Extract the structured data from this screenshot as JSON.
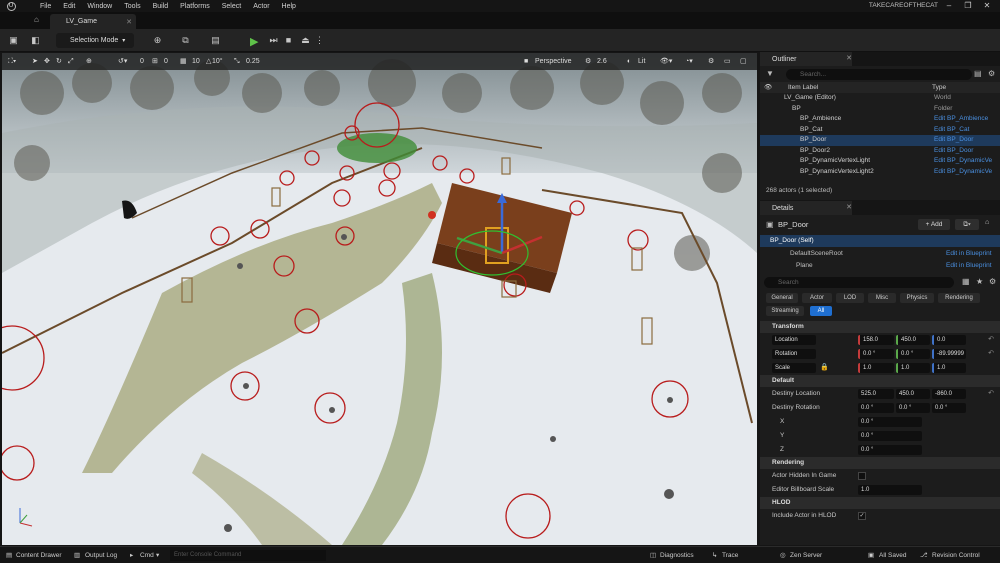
{
  "menubar": {
    "items": [
      "File",
      "Edit",
      "Window",
      "Tools",
      "Build",
      "Platforms",
      "Select",
      "Actor",
      "Help"
    ],
    "project": "TAKECAREOFTHECAT"
  },
  "tabs": {
    "level": "LV_Game"
  },
  "toolbar": {
    "selection_mode": "Selection Mode"
  },
  "viewport": {
    "view_mode": "Perspective",
    "fov": "2.6",
    "lighting": "Lit",
    "snap_move": "10",
    "snap_rotate": "10°",
    "snap_scale": "0.25",
    "count_a": "0",
    "count_b": "0"
  },
  "outliner": {
    "title": "Outliner",
    "search_placeholder": "Search...",
    "col_label": "Item Label",
    "col_type": "Type",
    "rows": [
      {
        "label": "LV_Game (Editor)",
        "type": "World",
        "link": false,
        "sel": false,
        "indent": 2
      },
      {
        "label": "BP",
        "type": "Folder",
        "link": false,
        "sel": false,
        "indent": 3
      },
      {
        "label": "BP_Ambience",
        "type": "Edit BP_Ambience",
        "link": true,
        "sel": false,
        "indent": 4
      },
      {
        "label": "BP_Cat",
        "type": "Edit BP_Cat",
        "link": true,
        "sel": false,
        "indent": 4
      },
      {
        "label": "BP_Door",
        "type": "Edit BP_Door",
        "link": true,
        "sel": true,
        "indent": 4
      },
      {
        "label": "BP_Door2",
        "type": "Edit BP_Door",
        "link": true,
        "sel": false,
        "indent": 4
      },
      {
        "label": "BP_DynamicVertexLight",
        "type": "Edit BP_DynamicVe",
        "link": true,
        "sel": false,
        "indent": 4
      },
      {
        "label": "BP_DynamicVertexLight2",
        "type": "Edit BP_DynamicVe",
        "link": true,
        "sel": false,
        "indent": 4
      }
    ],
    "footer": "268 actors (1 selected)"
  },
  "details": {
    "title": "Details",
    "actor": "BP_Door",
    "add_label": "+ Add",
    "self_label": "BP_Door (Self)",
    "root_label": "DefaultSceneRoot",
    "plane_label": "Plane",
    "edit_bp": "Edit in Blueprint",
    "search_placeholder": "Search",
    "tabs": [
      "General",
      "Actor",
      "LOD",
      "Misc",
      "Physics",
      "Rendering",
      "Streaming",
      "All"
    ],
    "transform": {
      "section": "Transform",
      "location_label": "Location",
      "rotation_label": "Rotation",
      "scale_label": "Scale",
      "location": [
        "158.0",
        "450.0",
        "0.0"
      ],
      "rotation": [
        "0.0 °",
        "0.0 °",
        "-89.99999"
      ],
      "scale": [
        "1.0",
        "1.0",
        "1.0"
      ]
    },
    "default": {
      "section": "Default",
      "dest_loc_label": "Destiny Location",
      "dest_loc": [
        "525.0",
        "450.0",
        "-860.0"
      ],
      "dest_rot_label": "Destiny Rotation",
      "dest_rot": [
        "0.0 °",
        "0.0 °",
        "0.0 °"
      ],
      "x_label": "X",
      "y_label": "Y",
      "z_label": "Z",
      "xyz": [
        "0.0 °",
        "0.0 °",
        "0.0 °"
      ]
    },
    "rendering": {
      "section": "Rendering",
      "hidden_label": "Actor Hidden In Game",
      "billboard_label": "Editor Billboard Scale",
      "billboard": "1.0"
    },
    "hlod": {
      "section": "HLOD",
      "include_label": "Include Actor in HLOD"
    }
  },
  "statusbar": {
    "content_drawer": "Content Drawer",
    "output_log": "Output Log",
    "cmd": "Cmd",
    "console_placeholder": "Enter Console Command",
    "diagnostics": "Diagnostics",
    "trace": "Trace",
    "zen": "Zen Server",
    "saved": "All Saved",
    "revision": "Revision Control"
  }
}
